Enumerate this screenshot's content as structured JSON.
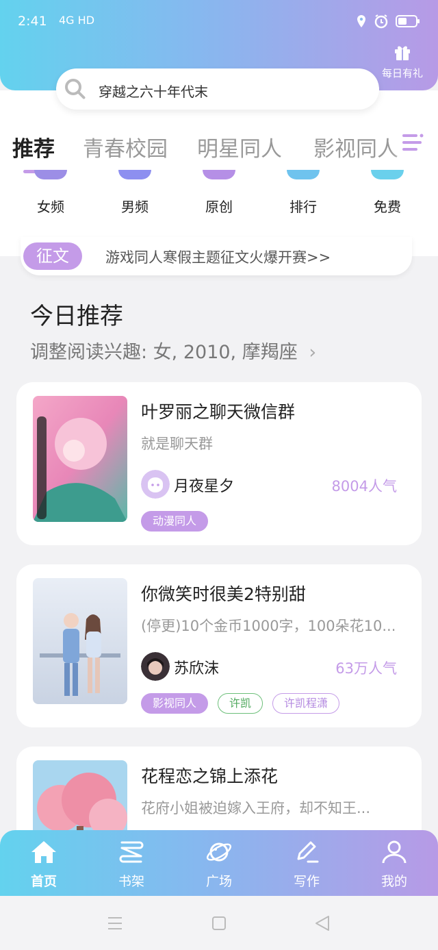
{
  "status_bar": {
    "time": "2:41",
    "network": "4G HD"
  },
  "gift": {
    "label": "每日有礼"
  },
  "search": {
    "query": "穿越之六十年代末"
  },
  "tabs": [
    "推荐",
    "青春校园",
    "明星同人",
    "影视同人"
  ],
  "categories": [
    {
      "label": "女频",
      "color": "#9c8ee6"
    },
    {
      "label": "男频",
      "color": "#8d8ff0"
    },
    {
      "label": "原创",
      "color": "#b58fe6"
    },
    {
      "label": "排行",
      "color": "#6fc3ee"
    },
    {
      "label": "免费",
      "color": "#6ad0ec"
    }
  ],
  "notice": {
    "badge": "征文",
    "text": "游戏同人寒假主题征文火爆开赛>>"
  },
  "section": {
    "title": "今日推荐",
    "subtitle": "调整阅读兴趣: 女, 2010, 摩羯座"
  },
  "books": [
    {
      "title": "叶罗丽之聊天微信群",
      "desc": "就是聊天群",
      "author": "月夜星夕",
      "popularity": "8004人气",
      "tags": [
        {
          "label": "动漫同人",
          "style": "filled"
        }
      ]
    },
    {
      "title": "你微笑时很美2特别甜",
      "desc": "(停更)10个金币1000字，100朵花10...",
      "author": "苏欣沫",
      "popularity": "63万人气",
      "tags": [
        {
          "label": "影视同人",
          "style": "filled"
        },
        {
          "label": "许凯",
          "style": "green"
        },
        {
          "label": "许凯程潇",
          "style": "purple"
        }
      ]
    },
    {
      "title": "花程恋之锦上添花",
      "desc": "花府小姐被迫嫁入王府，却不知王..."
    }
  ],
  "bottom_nav": [
    "首页",
    "书架",
    "广场",
    "写作",
    "我的"
  ],
  "colors": {
    "accent": "#c49be8",
    "gradient_start": "#63d2ee",
    "gradient_end": "#b79ae6"
  }
}
